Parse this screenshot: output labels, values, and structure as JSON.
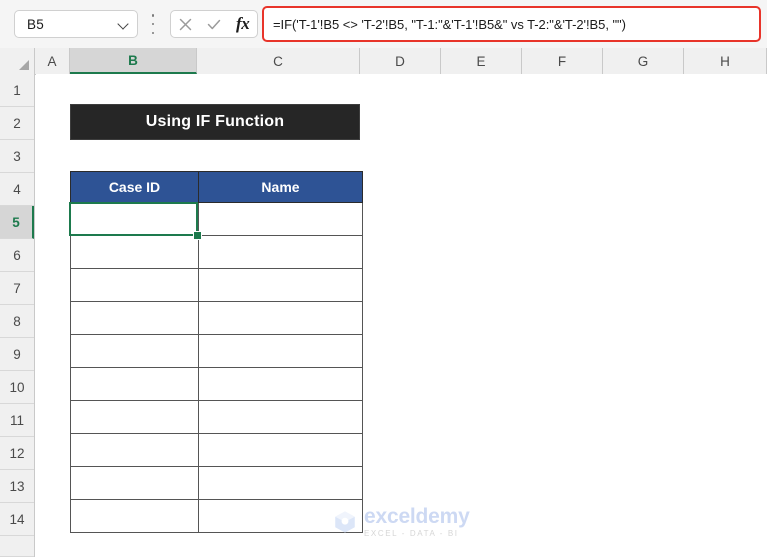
{
  "formula_bar": {
    "name_box_value": "B5",
    "name_box_dropdown_icon": "chevron-down-icon",
    "kebab_icon": "more-options-icon",
    "cancel_icon": "cancel-x-icon",
    "enter_icon": "enter-check-icon",
    "function_icon_label": "fx",
    "formula_text": "=IF('T-1'!B5 <> 'T-2'!B5, \"T-1:\"&'T-1'!B5&\" vs T-2:\"&'T-2'!B5, \"\")",
    "highlight_color": "#e8342a"
  },
  "grid": {
    "select_all_icon": "select-all-corner-icon",
    "columns": [
      "A",
      "B",
      "C",
      "D",
      "E",
      "F",
      "G",
      "H"
    ],
    "rows": [
      "1",
      "2",
      "3",
      "4",
      "5",
      "6",
      "7",
      "8",
      "9",
      "10",
      "11",
      "12",
      "13",
      "14"
    ],
    "active_cell": "B5",
    "active_column": "B",
    "active_row": "5",
    "selection_color": "#1d7a4d"
  },
  "sheet_content": {
    "title_banner": {
      "text": "Using IF Function",
      "background": "#262626",
      "text_color": "#ffffff"
    },
    "table": {
      "header_background": "#2e5395",
      "headers": [
        "Case ID",
        "Name"
      ],
      "rows": [
        [
          "",
          ""
        ],
        [
          "",
          ""
        ],
        [
          "",
          ""
        ],
        [
          "",
          ""
        ],
        [
          "",
          ""
        ],
        [
          "",
          ""
        ],
        [
          "",
          ""
        ],
        [
          "",
          ""
        ],
        [
          "",
          ""
        ],
        [
          "",
          ""
        ]
      ]
    }
  },
  "watermark": {
    "name": "exceldemy",
    "tagline": "EXCEL - DATA - BI",
    "logo_icon": "exceldemy-cube-logo-icon"
  }
}
